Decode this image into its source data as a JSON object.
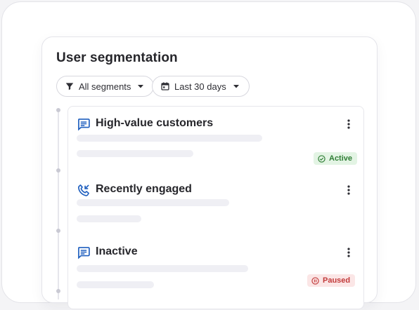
{
  "title": "User segmentation",
  "filters": {
    "segments": {
      "label": "All segments",
      "icon": "filter-icon"
    },
    "date_range": {
      "label": "Last 30 days",
      "icon": "calendar-icon"
    }
  },
  "colors": {
    "icon_blue": "#1f5fbf",
    "active_bg": "#e3f4e4",
    "active_text": "#2e7d34",
    "paused_bg": "#fbe6e6",
    "paused_text": "#c23b3b"
  },
  "segments": [
    {
      "name": "High-value customers",
      "icon": "chat-icon",
      "status": "Active"
    },
    {
      "name": "Recently engaged",
      "icon": "phone-callback-icon",
      "status": ""
    },
    {
      "name": "Inactive",
      "icon": "chat-icon",
      "status": "Paused"
    }
  ]
}
